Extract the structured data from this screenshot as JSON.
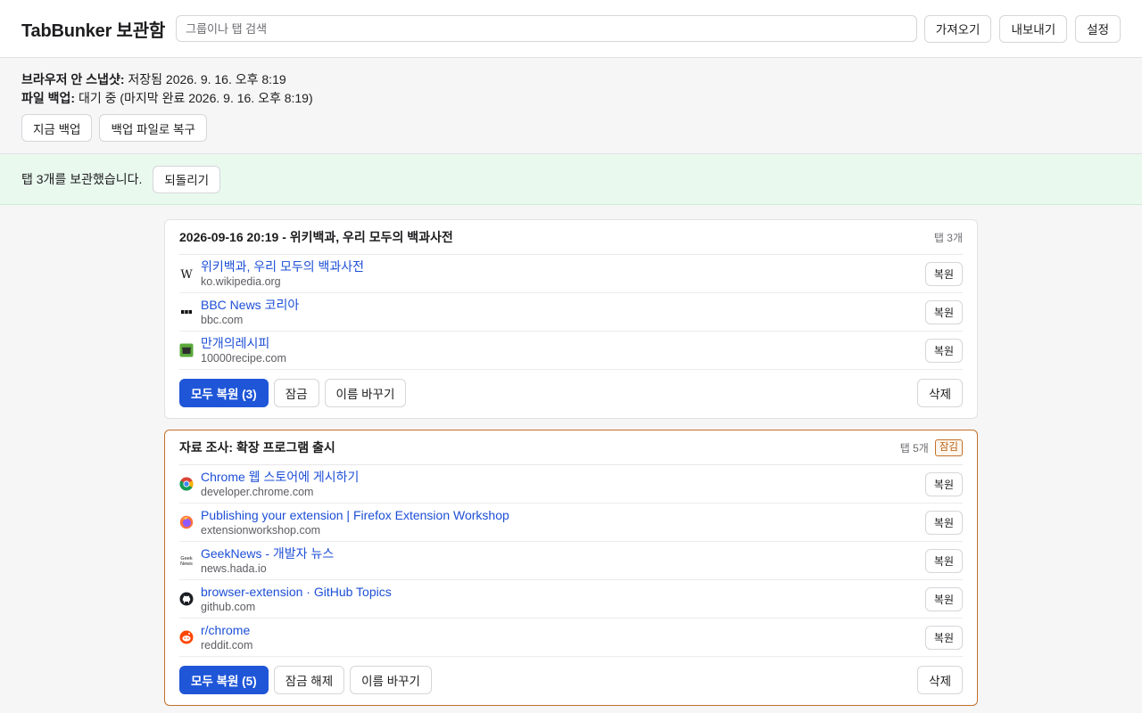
{
  "header": {
    "title": "TabBunker 보관함",
    "search_placeholder": "그룹이나 탭 검색",
    "import_label": "가져오기",
    "export_label": "내보내기",
    "settings_label": "설정"
  },
  "status": {
    "snapshot_label": "브라우저 안 스냅샷:",
    "snapshot_value": " 저장됨 2026. 9. 16. 오후 8:19",
    "file_backup_label": "파일 백업:",
    "file_backup_value": " 대기 중 (마지막 완료 2026. 9. 16. 오후 8:19)",
    "backup_now_label": "지금 백업",
    "restore_file_label": "백업 파일로 복구"
  },
  "toast": {
    "message": "탭 3개를 보관했습니다.",
    "undo_label": "되돌리기"
  },
  "groups": [
    {
      "title": "2026-09-16 20:19 - 위키백과, 우리 모두의 백과사전",
      "count": "탭 3개",
      "tabs": [
        {
          "title": "위키백과, 우리 모두의 백과사전",
          "domain": "ko.wikipedia.org",
          "icon": "wikipedia-icon",
          "restore": "복원"
        },
        {
          "title": "BBC News 코리아",
          "domain": "bbc.com",
          "icon": "bbc-icon",
          "restore": "복원"
        },
        {
          "title": "만개의레시피",
          "domain": "10000recipe.com",
          "icon": "recipe-icon",
          "restore": "복원"
        }
      ],
      "restore_all": "모두 복원 (3)",
      "lock": "잠금",
      "rename": "이름 바꾸기",
      "delete": "삭제"
    },
    {
      "title": "자료 조사: 확장 프로그램 출시",
      "count": "탭 5개",
      "badge": "잠김",
      "tabs": [
        {
          "title": "Chrome 웹 스토어에 게시하기",
          "domain": "developer.chrome.com",
          "icon": "chrome-icon",
          "restore": "복원"
        },
        {
          "title": "Publishing your extension | Firefox Extension Workshop",
          "domain": "extensionworkshop.com",
          "icon": "firefox-icon",
          "restore": "복원"
        },
        {
          "title": "GeekNews - 개발자 뉴스",
          "domain": "news.hada.io",
          "icon": "geeknews-icon",
          "icon_text": "Geek News",
          "restore": "복원"
        },
        {
          "title": "browser-extension · GitHub Topics",
          "domain": "github.com",
          "icon": "github-icon",
          "restore": "복원"
        },
        {
          "title": "r/chrome",
          "domain": "reddit.com",
          "icon": "reddit-icon",
          "restore": "복원"
        }
      ],
      "restore_all": "모두 복원 (5)",
      "unlock": "잠금 해제",
      "rename": "이름 바꾸기",
      "delete": "삭제"
    }
  ],
  "colors": {
    "primary": "#1f56d8",
    "link": "#1d4fd7",
    "locked_border": "#c2702a",
    "toast_bg": "#e9f9ee"
  }
}
